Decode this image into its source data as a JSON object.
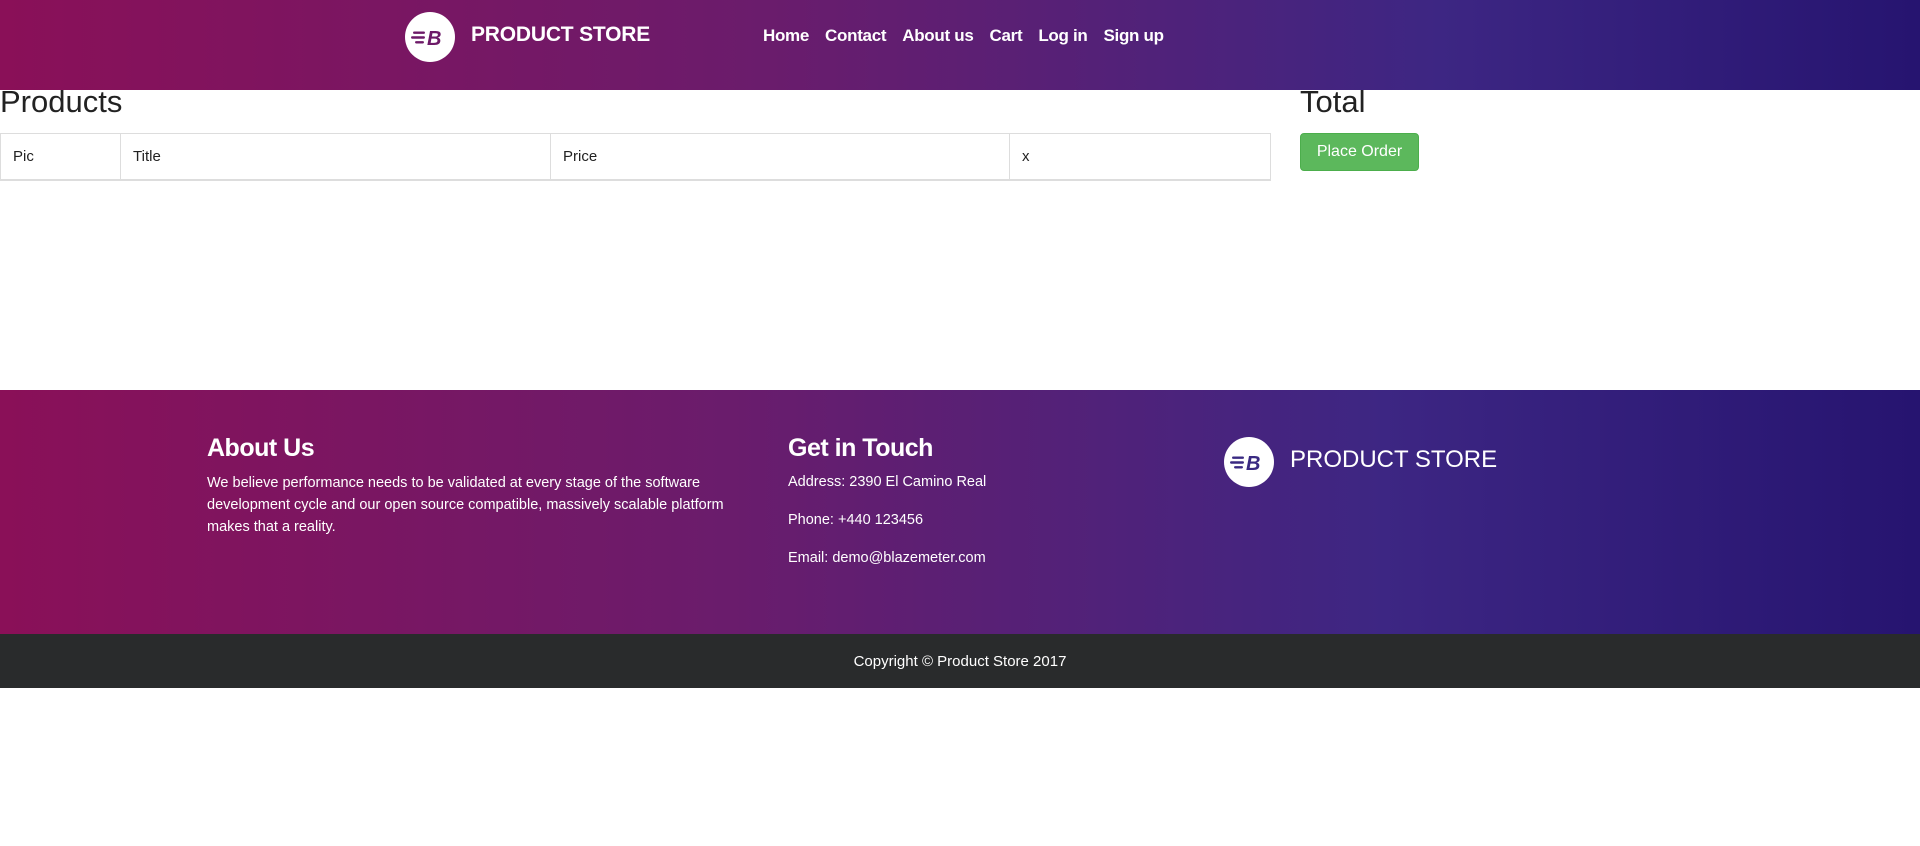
{
  "navbar": {
    "brand_name": "PRODUCT STORE",
    "logo_letter": "B",
    "links": [
      "Home",
      "Contact",
      "About us",
      "Cart",
      "Log in",
      "Sign up"
    ]
  },
  "products": {
    "title": "Products",
    "columns": [
      "Pic",
      "Title",
      "Price",
      "x"
    ],
    "rows": []
  },
  "total": {
    "title": "Total",
    "place_order_label": "Place Order"
  },
  "footer": {
    "about_title": "About Us",
    "about_text": "We believe performance needs to be validated at every stage of the software development cycle and our open source compatible, massively scalable platform makes that a reality.",
    "touch_title": "Get in Touch",
    "address": "Address: 2390 El Camino Real",
    "phone": "Phone: +440 123456",
    "email": "Email: demo@blazemeter.com",
    "brand_name": "PRODUCT STORE"
  },
  "copyright": "Copyright © Product Store 2017",
  "colors": {
    "gradient_start": "#8a1058",
    "gradient_end": "#261470",
    "logo_mark": "#6d1a68",
    "button_green": "#5cb85c",
    "copyright_bg": "#292b2c"
  }
}
